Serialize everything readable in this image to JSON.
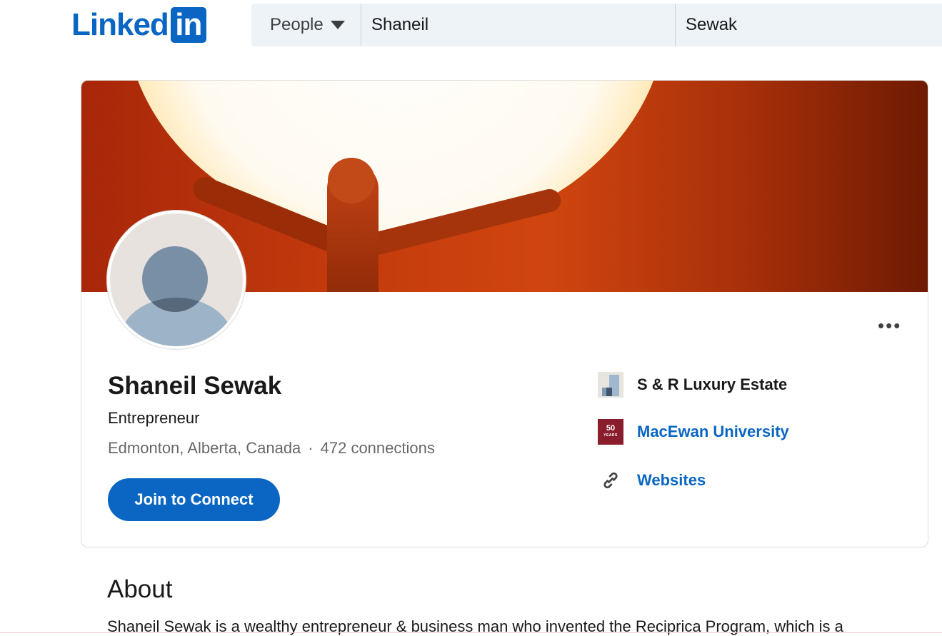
{
  "header": {
    "logo_text": "Linked",
    "logo_box_text": "in",
    "search_category": "People",
    "first_name_value": "Shaneil",
    "last_name_value": "Sewak"
  },
  "profile": {
    "name": "Shaneil Sewak",
    "headline": "Entrepreneur",
    "location": "Edmonton, Alberta, Canada",
    "separator": "·",
    "connections": "472 connections",
    "join_button": "Join to Connect",
    "more_label": "•••"
  },
  "side": {
    "company": "S & R Luxury Estate",
    "university": "MacEwan University",
    "university_logo_text": "50",
    "university_logo_sub": "YEARS",
    "websites": "Websites"
  },
  "about": {
    "title": "About",
    "text": "Shaneil Sewak is a wealthy entrepreneur & business man who invented the Reciprica Program, which is a"
  },
  "colors": {
    "brand": "#0a66c2",
    "university": "#8a1d2c"
  }
}
